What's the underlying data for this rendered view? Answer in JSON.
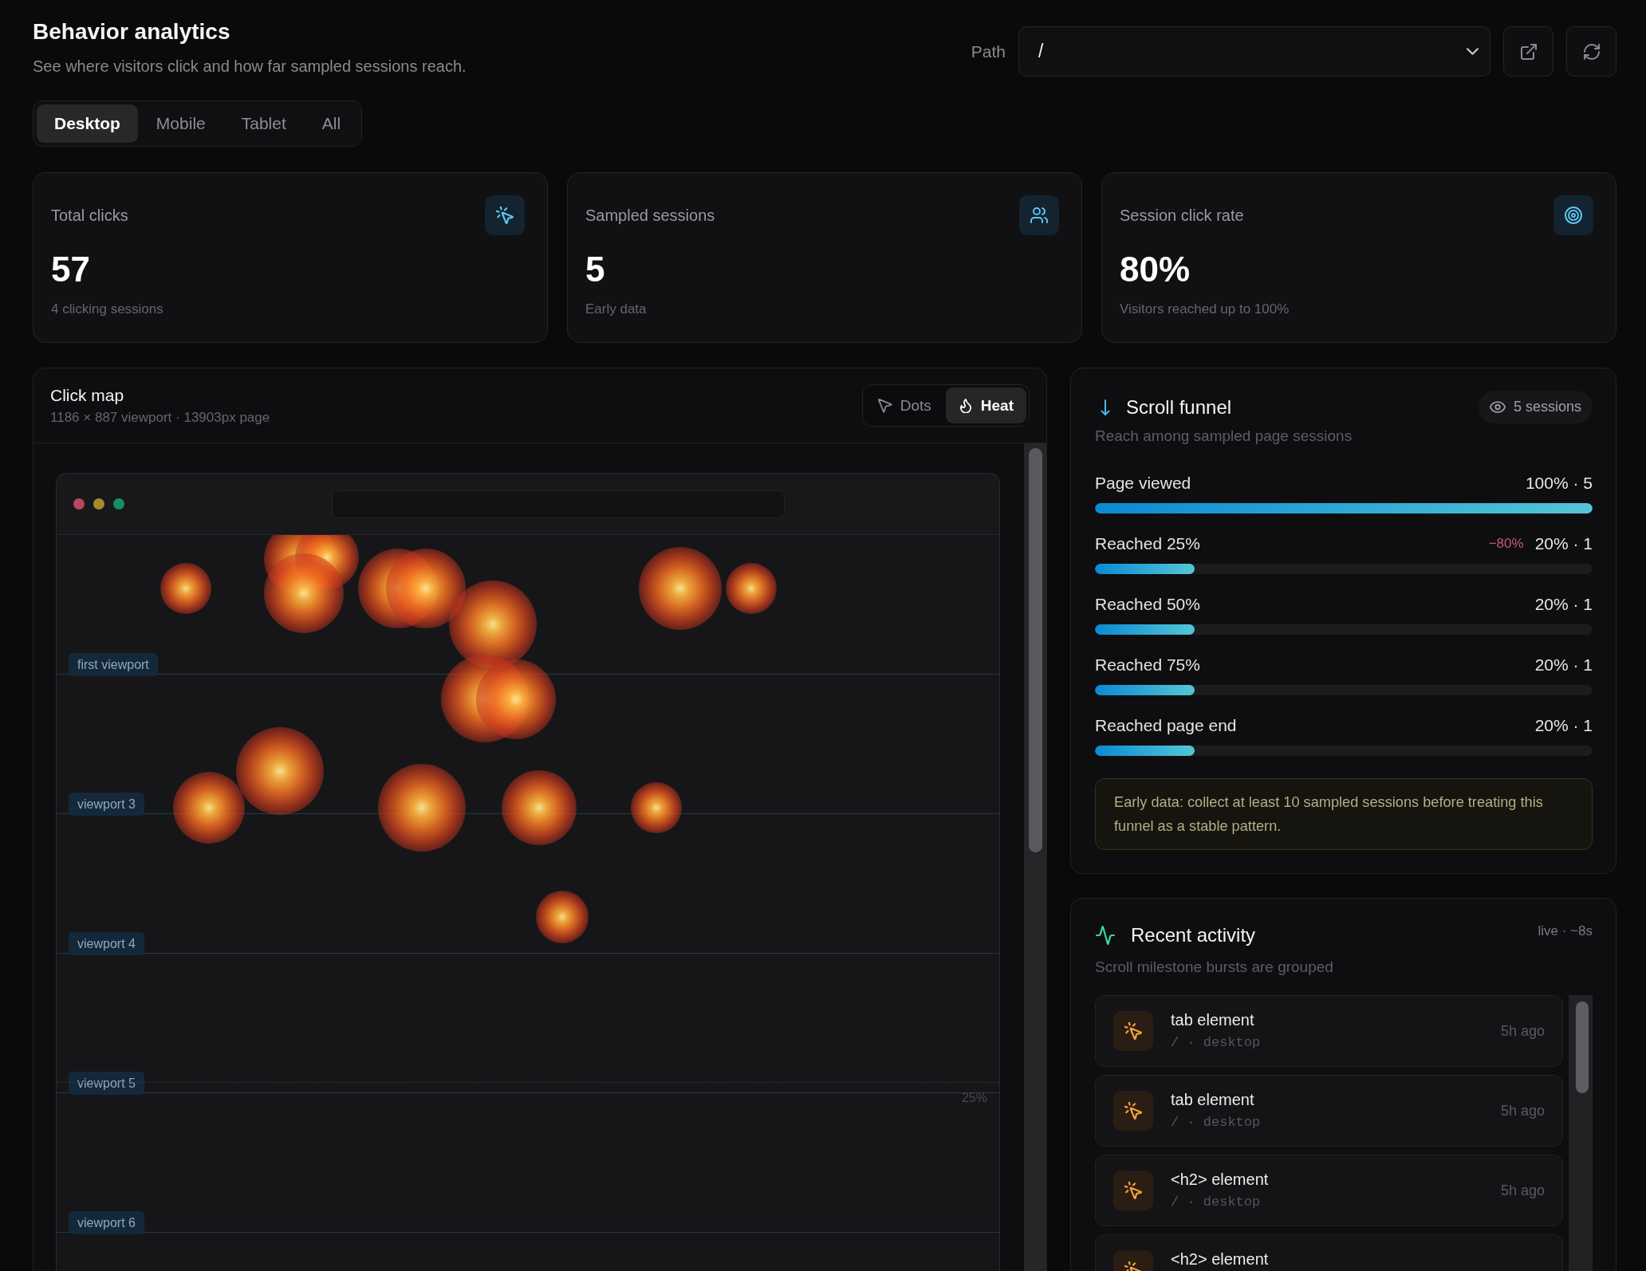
{
  "header": {
    "title": "Behavior analytics",
    "subtitle": "See where visitors click and how far sampled sessions reach.",
    "path_label": "Path",
    "path_select": {
      "value": "/"
    }
  },
  "device_tabs": [
    {
      "label": "Desktop",
      "selected": true
    },
    {
      "label": "Mobile",
      "selected": false
    },
    {
      "label": "Tablet",
      "selected": false
    },
    {
      "label": "All",
      "selected": false
    }
  ],
  "stats": [
    {
      "kind": "clicks",
      "label": "Total clicks",
      "value": "57",
      "note": "4 clicking sessions"
    },
    {
      "kind": "sessions",
      "label": "Sampled sessions",
      "value": "5",
      "note": "Early data"
    },
    {
      "kind": "rate",
      "label": "Session click rate",
      "value": "80%",
      "note": "Visitors reached up to 100%"
    }
  ],
  "click_map": {
    "title": "Click map",
    "subtitle": "1186 × 887 viewport · 13903px page",
    "modes": [
      {
        "kind": "dots",
        "label": "Dots",
        "selected": false
      },
      {
        "kind": "heat",
        "label": "Heat",
        "selected": true
      }
    ],
    "viewport_markers": [
      "first viewport",
      "viewport 3",
      "viewport 4",
      "viewport 5",
      "viewport 6"
    ],
    "scroll_marker": "25%"
  },
  "scroll_funnel": {
    "title": "Scroll funnel",
    "badge": "5 sessions",
    "subtitle": "Reach among sampled page sessions",
    "steps": [
      {
        "label": "Page viewed",
        "reading": "100% · 5",
        "level": 1
      },
      {
        "label": "Reached 25%",
        "drop": "−80%",
        "reading": "20% · 1",
        "level": 0.2
      },
      {
        "label": "Reached 50%",
        "reading": "20% · 1",
        "level": 0.2
      },
      {
        "label": "Reached 75%",
        "reading": "20% · 1",
        "level": 0.2
      },
      {
        "label": "Reached page end",
        "reading": "20% · 1",
        "level": 0.2
      }
    ],
    "note": "Early data: collect at least 10 sampled sessions before treating this funnel as a stable pattern."
  },
  "recent_activity": {
    "title": "Recent activity",
    "status": "live · ~8s",
    "subtitle": "Scroll milestone bursts are grouped",
    "events": [
      {
        "kind": "click",
        "title": "tab element",
        "meta": "/ · desktop",
        "time": "5h ago"
      },
      {
        "kind": "click",
        "title": "tab element",
        "meta": "/ · desktop",
        "time": "5h ago"
      },
      {
        "kind": "click",
        "title": "<h2> element",
        "meta": "/ · desktop",
        "time": "5h ago"
      },
      {
        "kind": "click",
        "title": "<h2> element"
      }
    ]
  }
}
